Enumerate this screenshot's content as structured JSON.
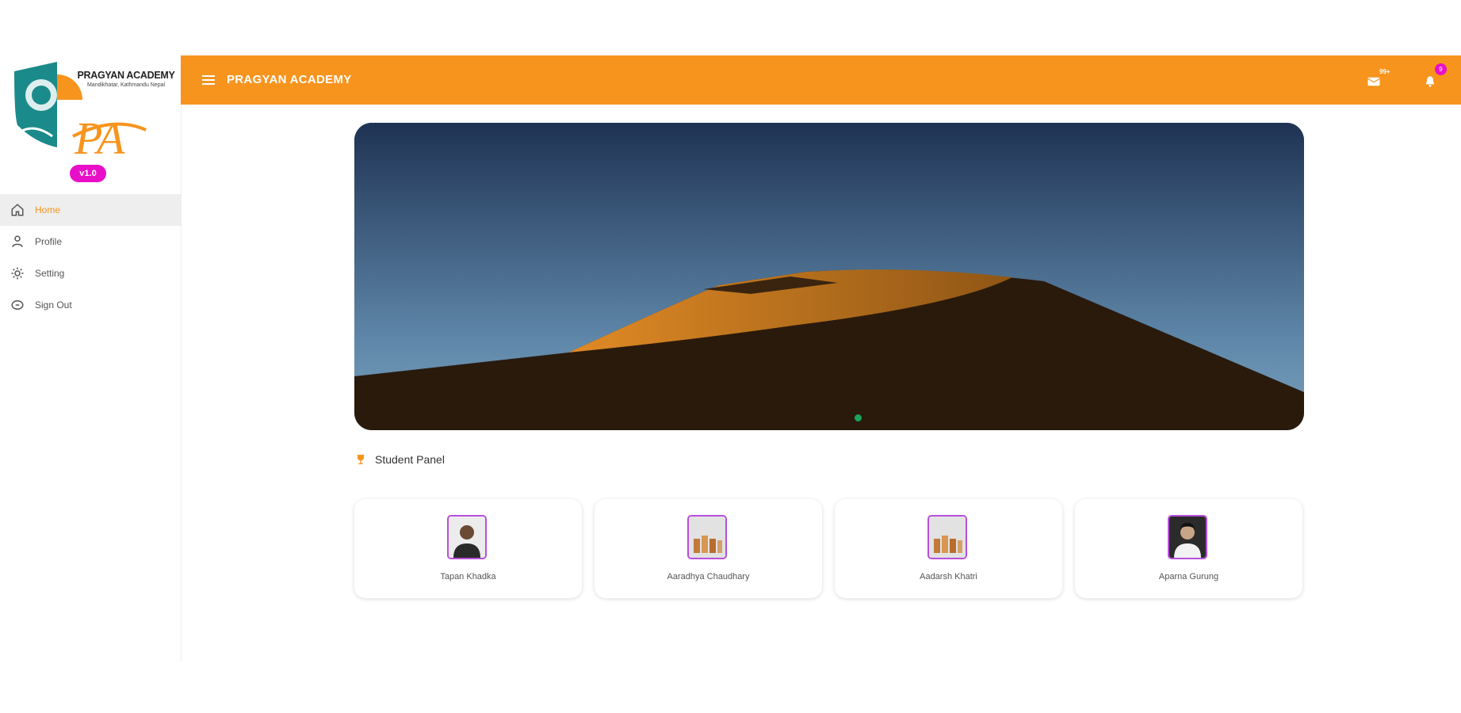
{
  "sidebar": {
    "logo": {
      "title": "PRAGYAN ACADEMY",
      "subtitle": "Mandikhatar, Kathmandu Nepal",
      "monogram": "PA"
    },
    "version": "v1.0",
    "items": [
      {
        "label": "Home",
        "icon": "home-icon",
        "active": true
      },
      {
        "label": "Profile",
        "icon": "profile-icon",
        "active": false
      },
      {
        "label": "Setting",
        "icon": "gear-icon",
        "active": false
      },
      {
        "label": "Sign Out",
        "icon": "sign-out-icon",
        "active": false
      }
    ]
  },
  "header": {
    "title": "PRAGYAN ACADEMY",
    "messages_badge": "99+",
    "notifications_badge": "9"
  },
  "panel": {
    "title": "Student Panel",
    "students": [
      {
        "name": "Tapan Khadka",
        "avatar": "photo"
      },
      {
        "name": "Aaradhya Chaudhary",
        "avatar": "placeholder"
      },
      {
        "name": "Aadarsh Khatri",
        "avatar": "placeholder"
      },
      {
        "name": "Aparna Gurung",
        "avatar": "photo"
      }
    ]
  },
  "colors": {
    "primary": "#f7941d",
    "badge": "#e90fc9",
    "avatar_border": "#b84fdb",
    "carousel_dot": "#1aa35a"
  }
}
